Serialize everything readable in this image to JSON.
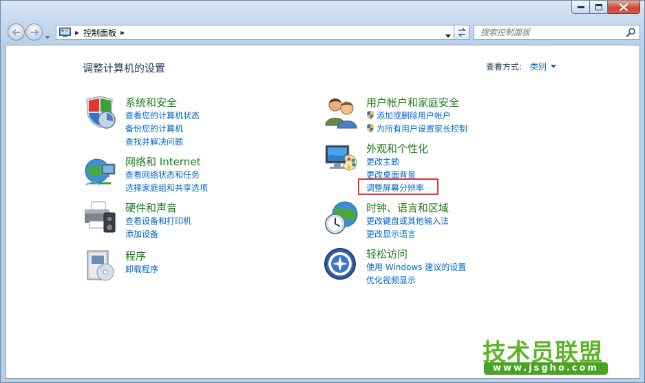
{
  "window": {
    "caption_buttons": [
      "minimize",
      "maximize",
      "close"
    ]
  },
  "address_bar": {
    "breadcrumb": "控制面板",
    "icon": "control-panel-icon"
  },
  "search": {
    "placeholder": "搜索控制面板"
  },
  "page": {
    "title": "调整计算机的设置",
    "view_by_label": "查看方式:",
    "view_by_value": "类别"
  },
  "categories": {
    "system_security": {
      "title": "系统和安全",
      "icon": "shield-icon",
      "links": [
        "查看您的计算机状态",
        "备份您的计算机",
        "查找并解决问题"
      ]
    },
    "network": {
      "title": "网络和 Internet",
      "icon": "network-globe-icon",
      "links": [
        "查看网络状态和任务",
        "选择家庭组和共享选项"
      ]
    },
    "hardware": {
      "title": "硬件和声音",
      "icon": "printer-icon",
      "links": [
        "查看设备和打印机",
        "添加设备"
      ]
    },
    "programs": {
      "title": "程序",
      "icon": "programs-box-icon",
      "links": [
        "卸载程序"
      ]
    },
    "user_accounts": {
      "title": "用户帐户和家庭安全",
      "icon": "users-icon",
      "links": [
        "添加或删除用户帐户",
        "为所有用户设置家长控制"
      ]
    },
    "appearance": {
      "title": "外观和个性化",
      "icon": "monitor-palette-icon",
      "links": [
        "更改主题",
        "更改桌面背景",
        "调整屏幕分辨率"
      ]
    },
    "clock_region": {
      "title": "时钟、语言和区域",
      "icon": "globe-clock-icon",
      "links": [
        "更改键盘或其他输入法",
        "更改显示语言"
      ]
    },
    "ease_of_access": {
      "title": "轻松访问",
      "icon": "ease-of-access-icon",
      "links": [
        "使用 Windows 建议的设置",
        "优化视频显示"
      ]
    }
  },
  "watermark": {
    "text": "技术员联盟",
    "url": "www.jsgho.com"
  },
  "colors": {
    "category_title": "#1d7a1a",
    "link": "#0066cc",
    "highlight_box": "#e0353b",
    "watermark_green": "#5fb52a"
  }
}
